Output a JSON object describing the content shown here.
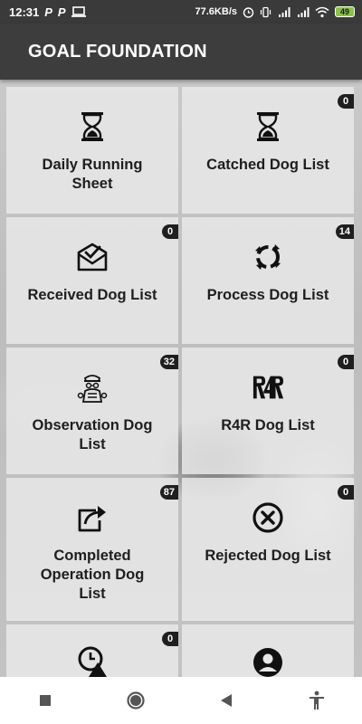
{
  "status_bar": {
    "time": "12:31",
    "notif_1": "P",
    "notif_2": "P",
    "net_speed": "77.6KB/s",
    "battery": "49"
  },
  "header": {
    "title": "GOAL FOUNDATION"
  },
  "tiles": [
    {
      "label": "Daily Running Sheet",
      "badge": "",
      "icon": "hourglass-icon"
    },
    {
      "label": "Catched Dog List",
      "badge": "0",
      "icon": "hourglass-icon"
    },
    {
      "label": "Received Dog List",
      "badge": "0",
      "icon": "mail-check-icon"
    },
    {
      "label": "Process Dog List",
      "badge": "14",
      "icon": "refresh-cycle-icon"
    },
    {
      "label": "Observation Dog List",
      "badge": "32",
      "icon": "inspector-icon"
    },
    {
      "label": "R4R Dog List",
      "badge": "0",
      "icon": "r4r-logo-icon"
    },
    {
      "label": "Completed Operation Dog List",
      "badge": "87",
      "icon": "share-out-icon"
    },
    {
      "label": "Rejected Dog List",
      "badge": "0",
      "icon": "x-circle-icon"
    },
    {
      "label": "",
      "badge": "0",
      "icon": "alert-clock-icon"
    },
    {
      "label": "",
      "badge": "",
      "icon": "user-circle-icon"
    }
  ],
  "nav_bar": {
    "items": [
      "recents-square-icon",
      "home-circle-icon",
      "back-triangle-icon",
      "accessibility-icon"
    ]
  }
}
